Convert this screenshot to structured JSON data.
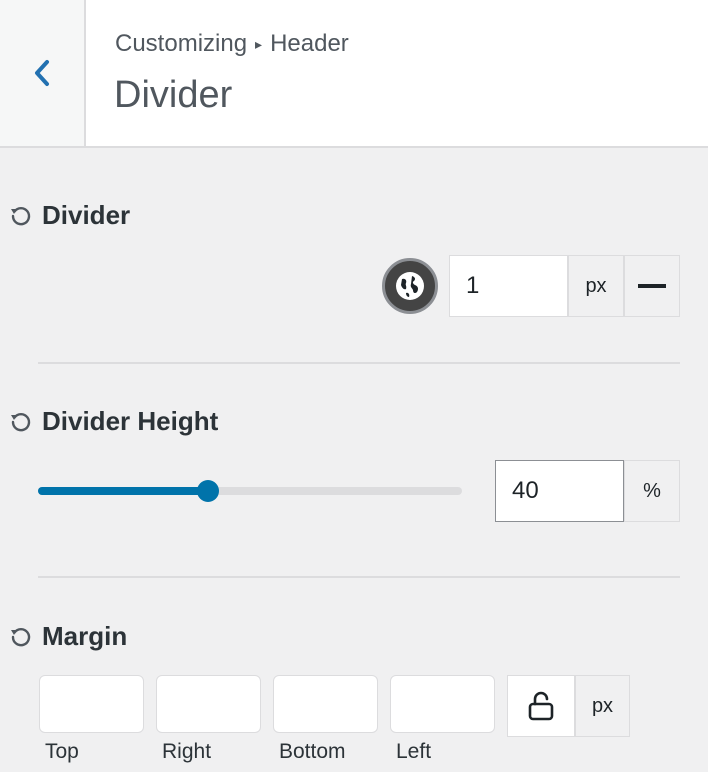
{
  "header": {
    "back_icon": "chevron-left-icon",
    "breadcrumb_parent": "Customizing",
    "breadcrumb_separator": "▸",
    "breadcrumb_current": "Header",
    "title": "Divider",
    "accent": "#2271b1"
  },
  "divider": {
    "label": "Divider",
    "reset_icon": "reset-icon",
    "color_icon": "globe-icon",
    "width_value": "1",
    "unit": "px",
    "style_icon": "solid-line-icon"
  },
  "divider_height": {
    "label": "Divider Height",
    "reset_icon": "reset-icon",
    "slider_level_percent": 40,
    "value": "40",
    "unit": "%",
    "slider_color": "#0073aa"
  },
  "margin": {
    "label": "Margin",
    "reset_icon": "reset-icon",
    "top_value": "",
    "right_value": "",
    "bottom_value": "",
    "left_value": "",
    "top_label": "Top",
    "right_label": "Right",
    "bottom_label": "Bottom",
    "left_label": "Left",
    "lock_icon": "unlocked-icon",
    "unit": "px"
  }
}
